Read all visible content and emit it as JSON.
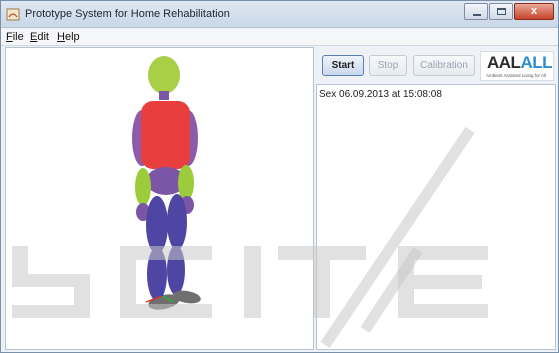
{
  "window": {
    "title": "Prototype System for Home Rehabilitation",
    "controls": {
      "close_glyph": "x"
    }
  },
  "menu": {
    "items": [
      {
        "label": "File",
        "mnemonic": "F",
        "rest": "ile"
      },
      {
        "label": "Edit",
        "mnemonic": "E",
        "rest": "dit"
      },
      {
        "label": "Help",
        "mnemonic": "H",
        "rest": "elp"
      }
    ]
  },
  "toolbar": {
    "start_label": "Start",
    "stop_label": "Stop",
    "calibration_label": "Calibration"
  },
  "logo": {
    "aal": "AAL",
    "all": "ALL",
    "tagline": "Ambient Assisted Living for All"
  },
  "log": {
    "lines": [
      "Sex 06.09.2013 at 15:08:08"
    ]
  },
  "watermark": {
    "text": "SCITE"
  },
  "colors": {
    "head": "#a9cf47",
    "torso": "#e83e3e",
    "upper_arm": "#8e5bab",
    "forearm": "#9ccb3b",
    "hand": "#7c56a6",
    "legs": "#4f45a3",
    "feet": "#6f6f6f",
    "accent": "#2a8ed0"
  }
}
